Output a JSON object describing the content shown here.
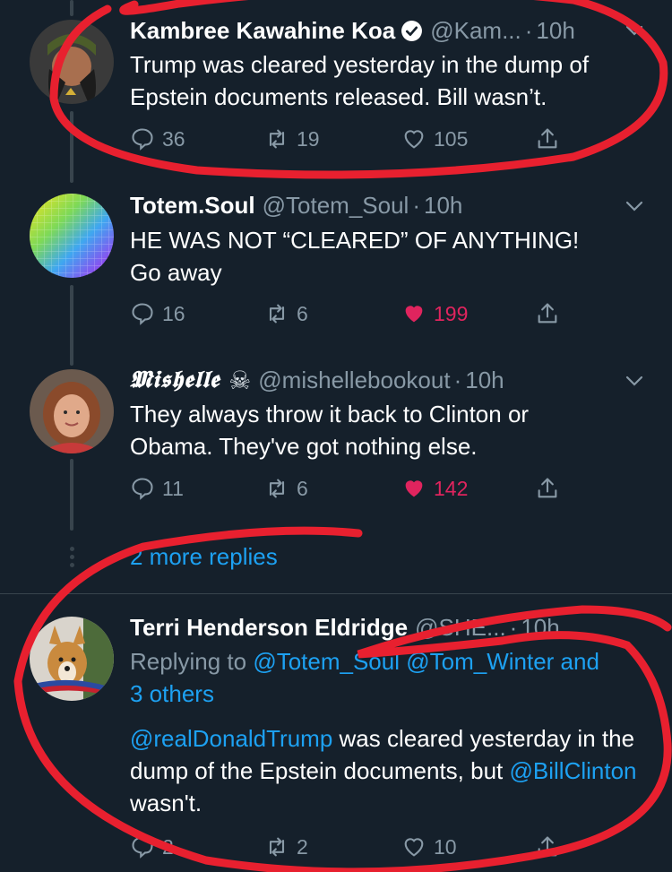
{
  "tweets": [
    {
      "name": "Kambree Kawahine Koa",
      "handle": "@Kam...",
      "sep": "·",
      "time": "10h",
      "text": "Trump was cleared yesterday in the dump of Epstein documents released. Bill wasn’t.",
      "replies": "36",
      "retweets": "19",
      "likes": "105"
    },
    {
      "name": "Totem.Soul",
      "handle": "@Totem_Soul",
      "sep": "·",
      "time": "10h",
      "text_line1": "HE WAS NOT “CLEARED” OF ANYTHING!",
      "text_line2": "Go away",
      "replies": "16",
      "retweets": "6",
      "likes": "199"
    },
    {
      "name": "𝕸𝖎𝖘𝖍𝖊𝖑𝖑𝖊",
      "skull": "☠",
      "handle": "@mishellebookout",
      "sep": "·",
      "time": "10h",
      "text": "They always throw it back to Clinton or Obama. They've got nothing else.",
      "replies": "11",
      "retweets": "6",
      "likes": "142"
    },
    {
      "name": "Terri Henderson Eldridge",
      "handle": "@SHE...",
      "sep": "·",
      "time": "10h",
      "replying_prefix": "Replying to",
      "replying_handles": "@Totem_Soul @Tom_Winter and",
      "replying_others": "3 others",
      "mention1": "@realDonaldTrump",
      "text_part1": " was cleared yesterday in the dump of the Epstein documents, but",
      "mention2": "@BillClinton",
      "text_part2": " wasn't.",
      "replies": "2",
      "retweets": "2",
      "likes": "10"
    }
  ],
  "more_replies": "2 more replies",
  "colors": {
    "background": "#15202b",
    "link": "#1da1f2",
    "muted": "#8899a6",
    "like": "#e0245e",
    "annotation": "#e8202f"
  },
  "icons": [
    "verified-badge-icon",
    "chevron-down-icon",
    "reply-icon",
    "retweet-icon",
    "like-icon",
    "share-icon",
    "skull-crossbones-icon"
  ]
}
